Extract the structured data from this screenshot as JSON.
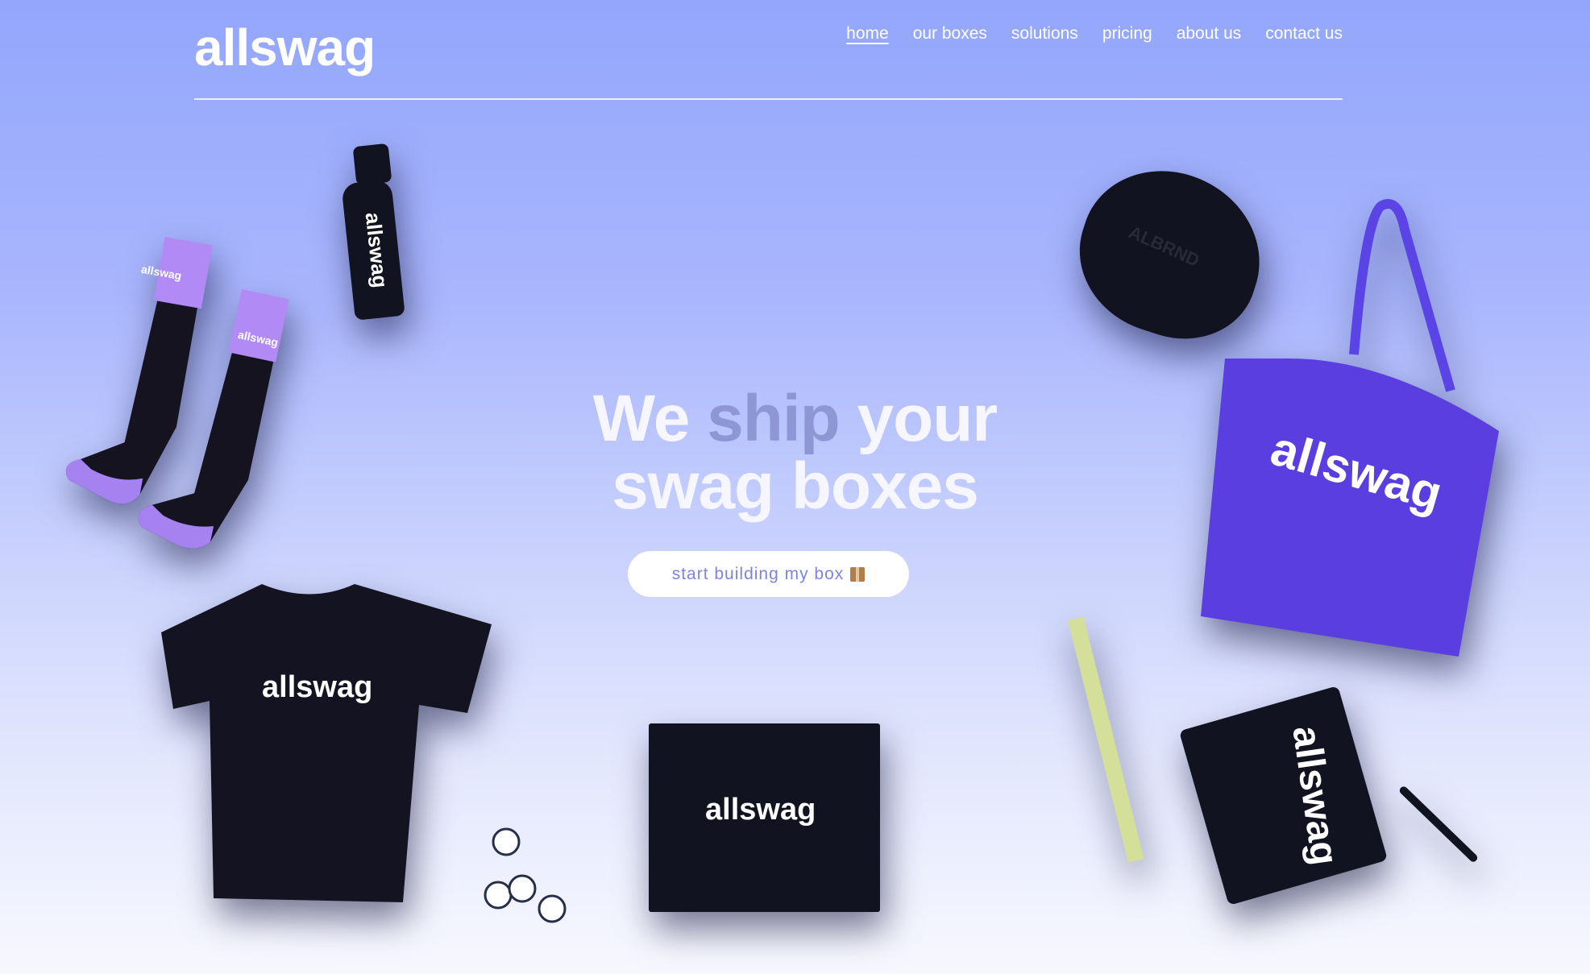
{
  "header": {
    "logo": "allswag",
    "nav": [
      "home",
      "our boxes",
      "solutions",
      "pricing",
      "about us",
      "contact us"
    ],
    "active_nav": "home"
  },
  "hero": {
    "line1_a": "We",
    "line1_b": "ship",
    "line1_c": "your",
    "line2": "swag boxes",
    "cta_label": "start building my box"
  },
  "products": {
    "bottle_brand": "allswag",
    "sock_brand": "allswag",
    "cap_text": "ALBRND",
    "tote_brand": "allswag",
    "tshirt_brand": "allswag",
    "box_brand": "allswag",
    "notebook_brand": "allswag"
  },
  "colors": {
    "bg_top": "#93a6fc",
    "bg_bottom": "#f7f8fe",
    "accent": "#7d84e0",
    "tote": "#5a3ee0",
    "lanyard": "#d4df9a"
  }
}
